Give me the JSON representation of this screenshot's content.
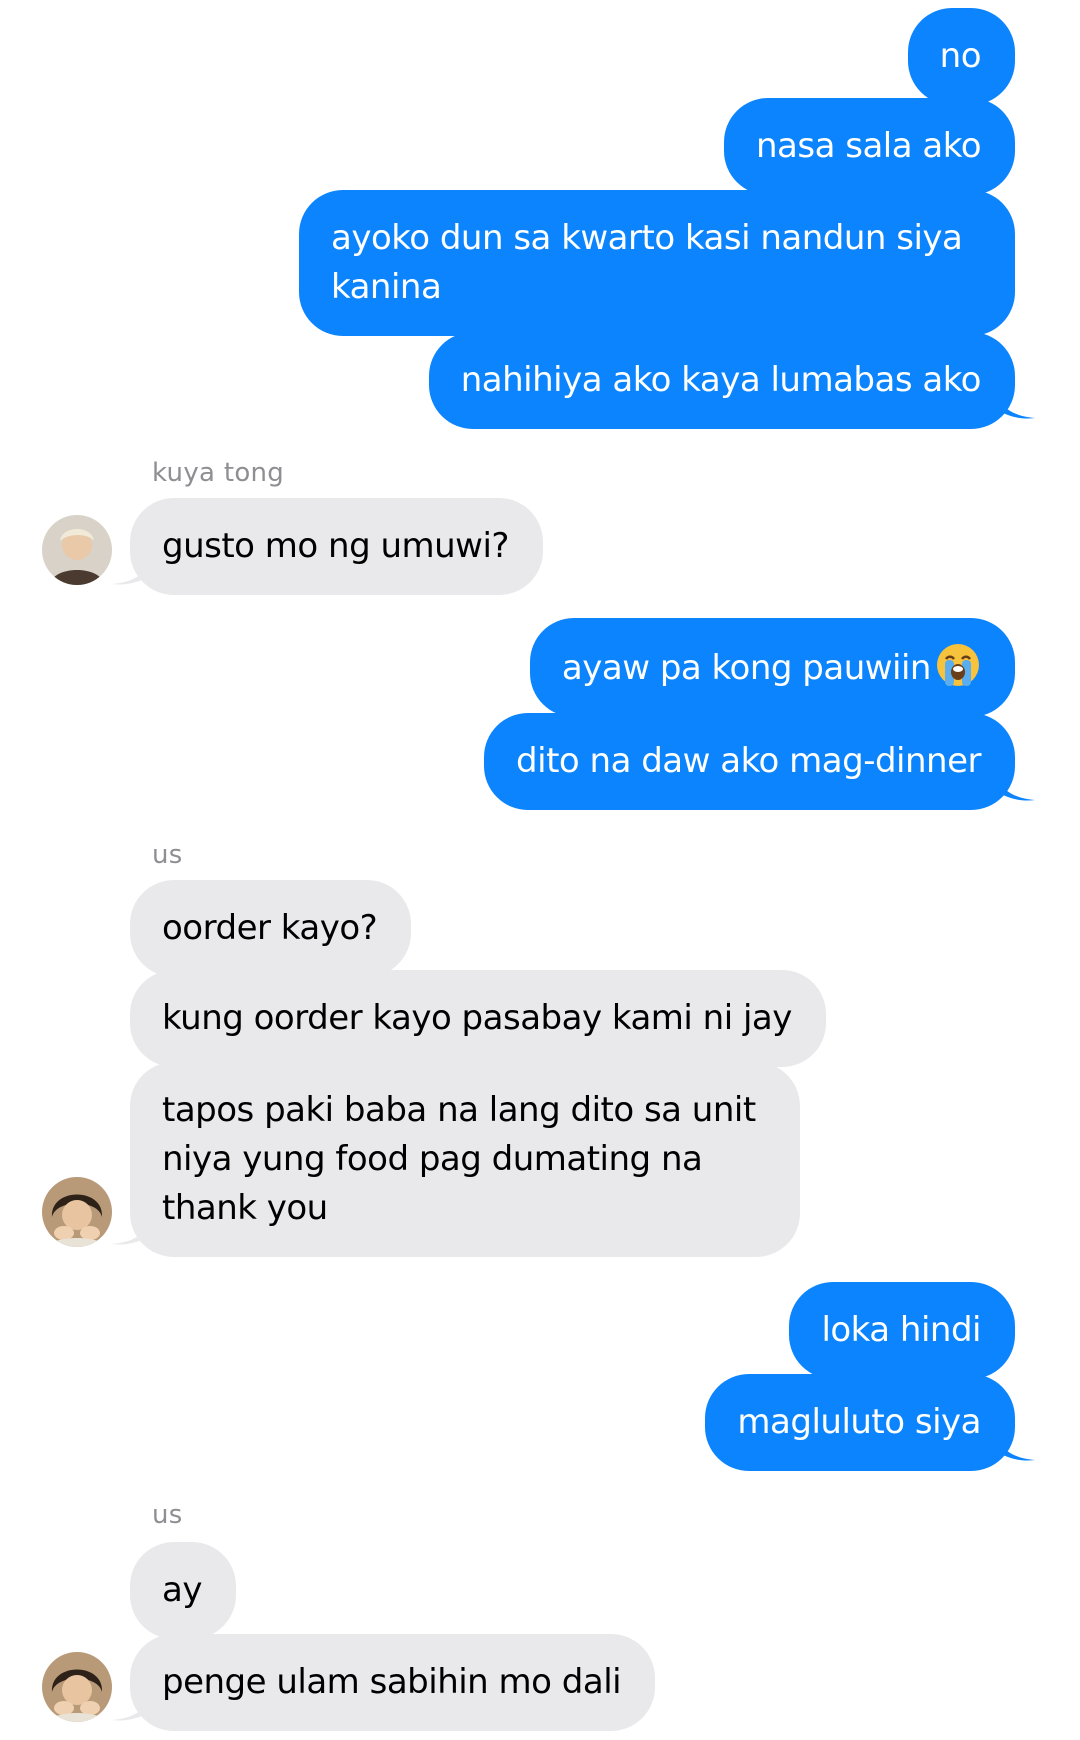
{
  "messages": {
    "m1": "no",
    "m2": "nasa sala ako",
    "m3": "ayoko dun sa kwarto kasi nandun siya kanina",
    "m4": "nahihiya ako kaya lumabas ako",
    "sender1": "kuya tong",
    "m5": "gusto mo ng umuwi?",
    "m6": "ayaw pa kong pauwiin",
    "m6_emoji": "crying-face-emoji",
    "m7": "dito na daw ako mag-dinner",
    "sender2": "us",
    "m8": "oorder kayo?",
    "m9": "kung oorder kayo pasabay kami ni jay",
    "m10": "tapos paki baba na lang dito sa unit niya yung food pag dumating na thank you",
    "m11": "loka hindi",
    "m12": "magluluto siya",
    "sender3": "us",
    "m13": "ay",
    "m14": "penge ulam sabihin mo dali"
  },
  "colors": {
    "outgoing_bubble": "#0b84fe",
    "incoming_bubble": "#e9e9eb",
    "sender_label": "#8e8e93",
    "background": "#ffffff"
  }
}
